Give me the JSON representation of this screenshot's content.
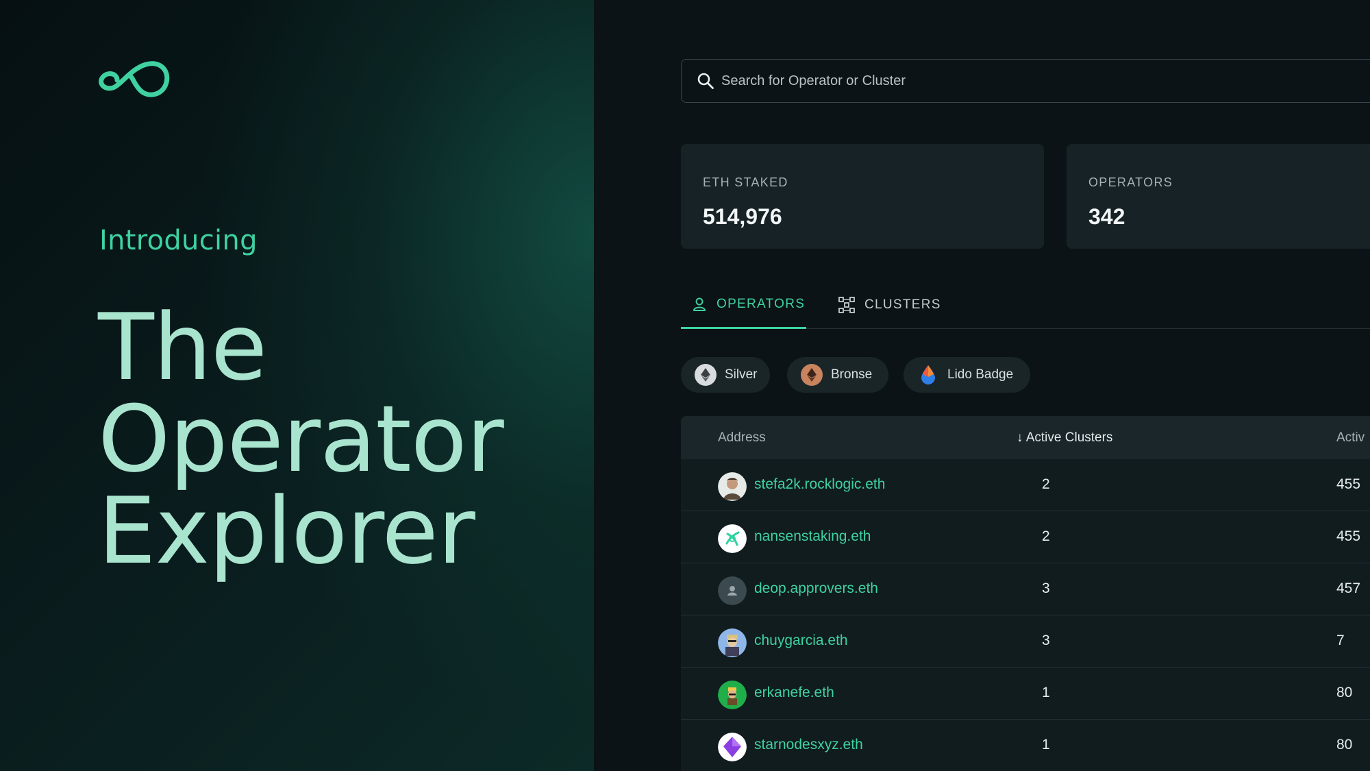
{
  "hero": {
    "intro": "Introducing",
    "headline": [
      "The",
      "Operator",
      "Explorer"
    ],
    "logo_icon": "infinity-logo-icon"
  },
  "search": {
    "placeholder": "Search for Operator or Cluster",
    "icon": "search-icon"
  },
  "stats": [
    {
      "label": "ETH STAKED",
      "value": "514,976"
    },
    {
      "label": "OPERATORS",
      "value": "342"
    }
  ],
  "tabs": [
    {
      "label": "OPERATORS",
      "icon": "user-icon",
      "active": true
    },
    {
      "label": "CLUSTERS",
      "icon": "cluster-icon",
      "active": false
    }
  ],
  "filters": [
    {
      "label": "Silver",
      "icon": "silver-eth-badge-icon"
    },
    {
      "label": "Bronse",
      "icon": "bronze-eth-badge-icon"
    },
    {
      "label": "Lido Badge",
      "icon": "lido-drop-icon"
    }
  ],
  "table": {
    "columns": [
      "Address",
      "↓ Active Clusters",
      "Activ"
    ],
    "rows": [
      {
        "address": "stefa2k.rocklogic.eth",
        "active_clusters": "2",
        "third": "455"
      },
      {
        "address": "nansenstaking.eth",
        "active_clusters": "2",
        "third": "455"
      },
      {
        "address": "deop.approvers.eth",
        "active_clusters": "3",
        "third": "457"
      },
      {
        "address": "chuygarcia.eth",
        "active_clusters": "3",
        "third": "7"
      },
      {
        "address": "erkanefe.eth",
        "active_clusters": "1",
        "third": "80"
      },
      {
        "address": "starnodesxyz.eth",
        "active_clusters": "1",
        "third": "80"
      }
    ]
  },
  "colors": {
    "accent": "#3fd2a0",
    "headline": "#a9e4cf",
    "panel": "#162226",
    "background": "#0b1316"
  }
}
